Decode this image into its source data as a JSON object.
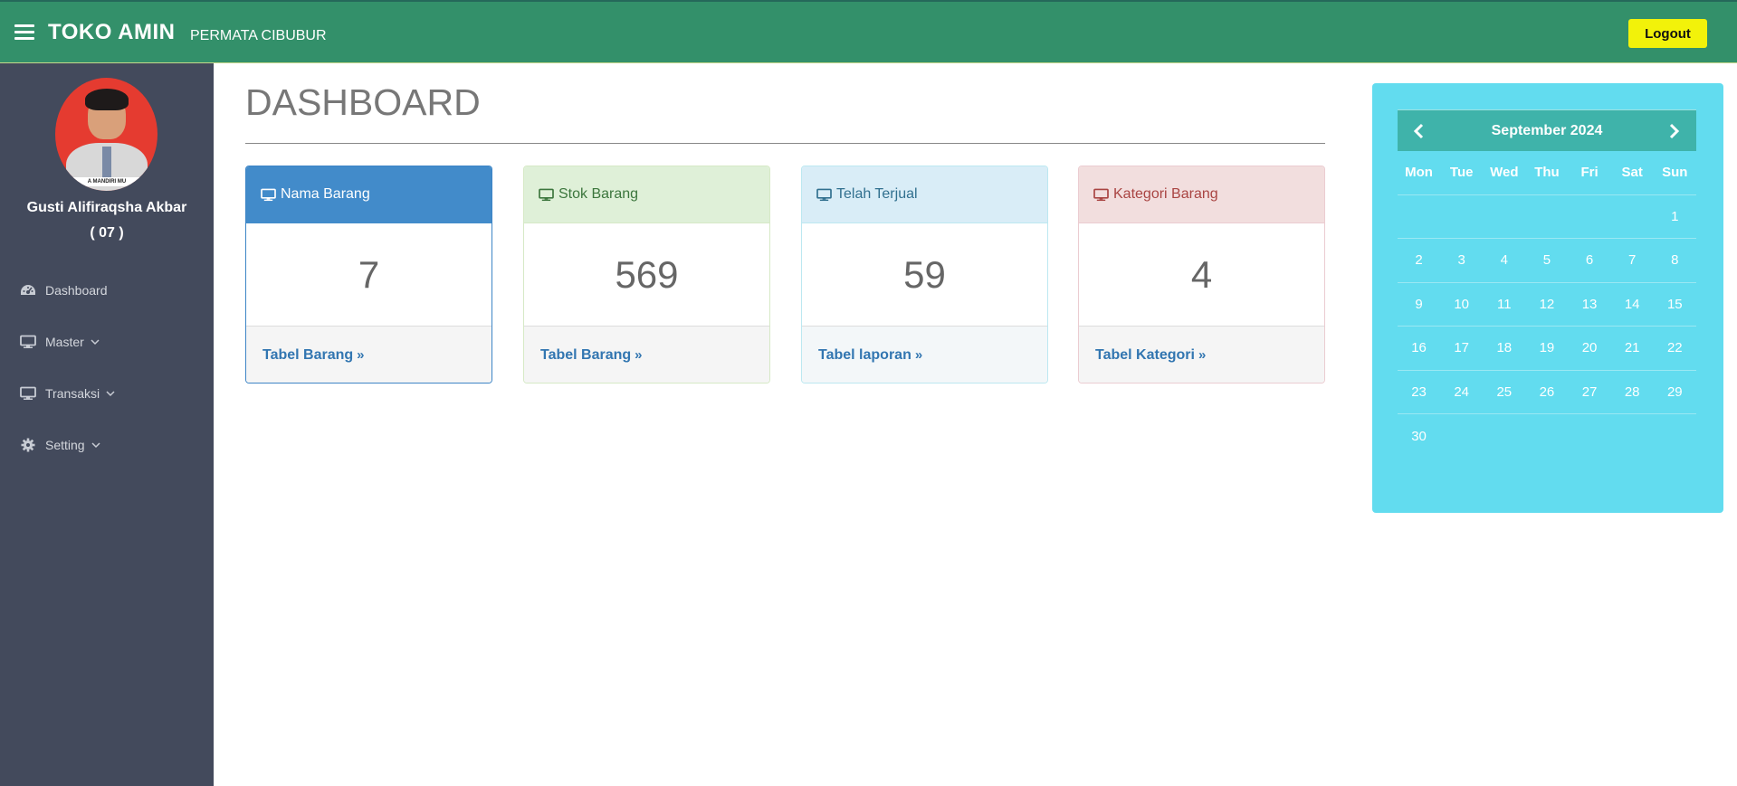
{
  "header": {
    "brand": "TOKO AMIN",
    "subtitle": "PERMATA CIBUBUR",
    "logout_label": "Logout",
    "bg_color": "#33906a",
    "logout_color": "#f2f20a"
  },
  "sidebar": {
    "user_name": "Gusti Alifiraqsha Akbar",
    "user_id": "( 07 )",
    "avatar_badge": "A MANDIRI MU",
    "items": [
      {
        "label": "Dashboard",
        "icon": "dashboard-icon"
      },
      {
        "label": "Master",
        "icon": "desktop-icon",
        "has_submenu": true
      },
      {
        "label": "Transaksi",
        "icon": "desktop-icon",
        "has_submenu": true
      },
      {
        "label": "Setting",
        "icon": "gear-icon",
        "has_submenu": true
      }
    ]
  },
  "main": {
    "title": "DASHBOARD",
    "cards": [
      {
        "title": "Nama Barang",
        "value": "7",
        "link": "Tabel Barang",
        "color": "#428bca"
      },
      {
        "title": "Stok Barang",
        "value": "569",
        "link": "Tabel Barang",
        "color": "#dff0d8"
      },
      {
        "title": "Telah Terjual",
        "value": "59",
        "link": "Tabel laporan",
        "color": "#d9edf7"
      },
      {
        "title": "Kategori Barang",
        "value": "4",
        "link": "Tabel Kategori",
        "color": "#f2dede"
      }
    ]
  },
  "calendar": {
    "month_label": "September 2024",
    "weekdays": [
      "Mon",
      "Tue",
      "Wed",
      "Thu",
      "Fri",
      "Sat",
      "Sun"
    ],
    "weeks": [
      [
        "",
        "",
        "",
        "",
        "",
        "",
        "1"
      ],
      [
        "2",
        "3",
        "4",
        "5",
        "6",
        "7",
        "8"
      ],
      [
        "9",
        "10",
        "11",
        "12",
        "13",
        "14",
        "15"
      ],
      [
        "16",
        "17",
        "18",
        "19",
        "20",
        "21",
        "22"
      ],
      [
        "23",
        "24",
        "25",
        "26",
        "27",
        "28",
        "29"
      ],
      [
        "30",
        "",
        "",
        "",
        "",
        "",
        ""
      ]
    ],
    "panel_color": "#62dcef",
    "header_color": "#3fb3aa"
  }
}
